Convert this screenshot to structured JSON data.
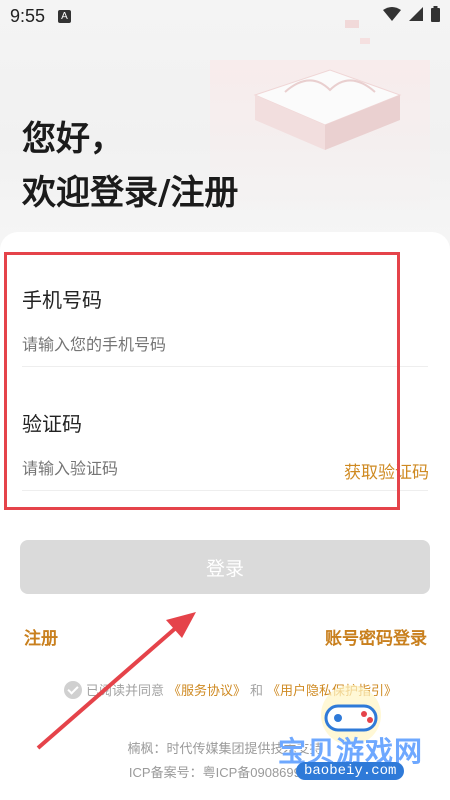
{
  "status_bar": {
    "time": "9:55",
    "notification_icon": "A",
    "icons": [
      "wifi-icon",
      "signal-icon",
      "battery-icon"
    ]
  },
  "hero": {
    "greeting": "您好，",
    "welcome": "欢迎登录/注册"
  },
  "form": {
    "phone_label": "手机号码",
    "phone_placeholder": "请输入您的手机号码",
    "code_label": "验证码",
    "code_placeholder": "请输入验证码",
    "get_code": "获取验证码"
  },
  "actions": {
    "login": "登录",
    "register": "注册",
    "password_login": "账号密码登录"
  },
  "agreement": {
    "prefix": "已阅读并同意",
    "service": "《服务协议》",
    "and": "和",
    "privacy": "《用户隐私保护指引》"
  },
  "footer": {
    "line1": "楠枫：时代传媒集团提供技术支持",
    "line2": "ICP备案号：粤ICP备09086999号"
  },
  "watermark": {
    "text": "宝贝游戏网",
    "url": "baobeiy.com"
  },
  "colors": {
    "accent": "#cf8a22",
    "highlight_box": "#e5434a",
    "login_disabled": "#dadada"
  }
}
